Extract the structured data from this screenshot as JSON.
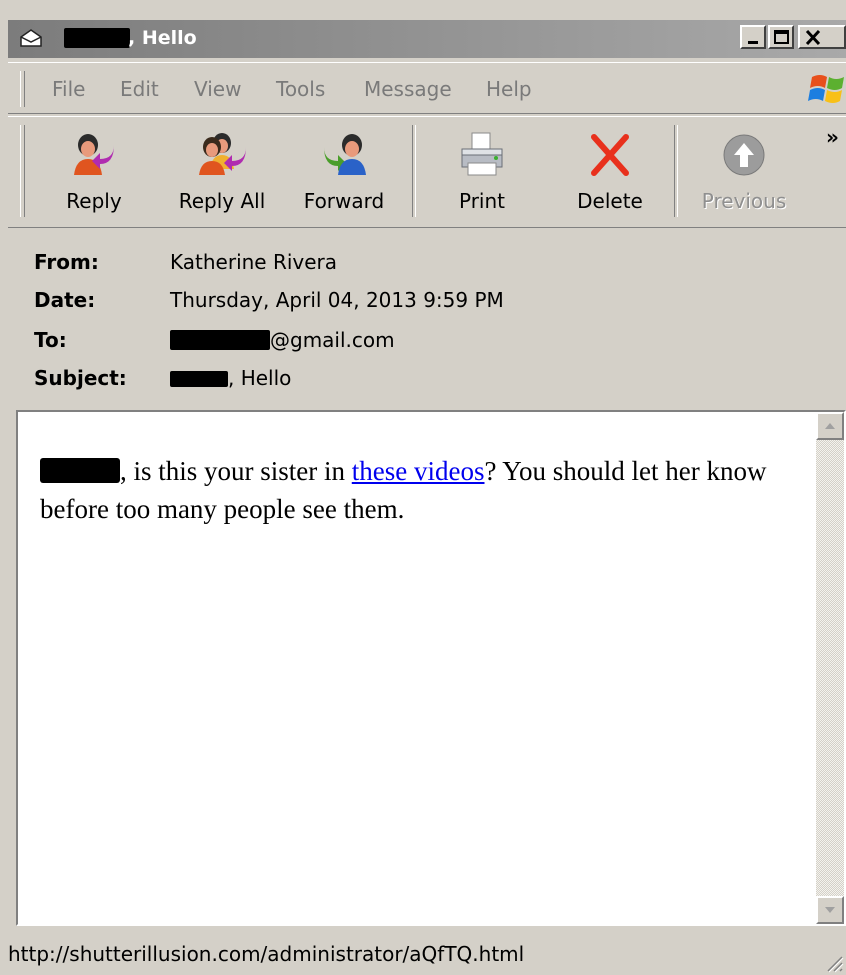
{
  "window": {
    "title_suffix": ", Hello",
    "icons": {
      "app": "envelope-icon",
      "minimize": "minimize-icon",
      "maximize": "maximize-icon",
      "close": "close-icon"
    }
  },
  "menubar": {
    "items": [
      "File",
      "Edit",
      "View",
      "Tools",
      "Message",
      "Help"
    ],
    "logo": "windows-flag-icon"
  },
  "toolbar": {
    "buttons": [
      {
        "label": "Reply",
        "icon": "reply-icon"
      },
      {
        "label": "Reply All",
        "icon": "reply-all-icon"
      },
      {
        "label": "Forward",
        "icon": "forward-icon"
      },
      {
        "label": "Print",
        "icon": "printer-icon"
      },
      {
        "label": "Delete",
        "icon": "delete-x-icon"
      },
      {
        "label": "Previous",
        "icon": "previous-arrow-icon",
        "disabled": true
      }
    ],
    "overflow": "»"
  },
  "header": {
    "from_label": "From:",
    "from_value": "Katherine Rivera",
    "date_label": "Date:",
    "date_value": "Thursday, April 04, 2013 9:59 PM",
    "to_label": "To:",
    "to_suffix": "@gmail.com",
    "subject_label": "Subject:",
    "subject_suffix": ", Hello"
  },
  "message": {
    "part1": ", is this your sister in ",
    "link_text": "these videos",
    "part2": "? You should let her know before too many people see them."
  },
  "statusbar": {
    "url": "http://shutterillusion.com/administrator/aQfTQ.html"
  },
  "colors": {
    "face": "#d4d0c8",
    "link": "#0000ee",
    "delete_red": "#e8301c"
  }
}
